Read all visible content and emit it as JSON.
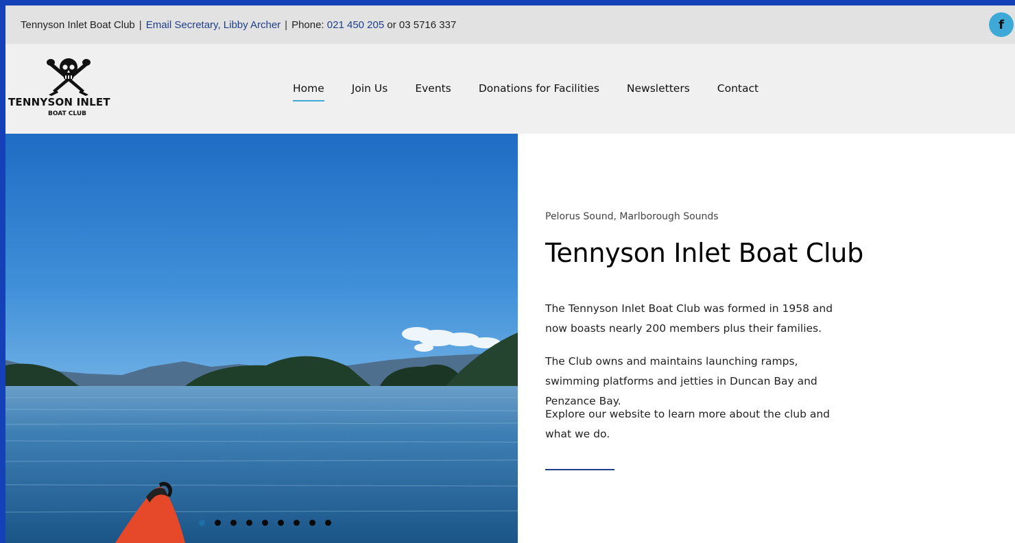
{
  "topbar": {
    "club_name": "Tennyson Inlet Boat Club",
    "separator": "|",
    "email_link": "Email Secretary, Libby Archer",
    "phone_label": "Phone:",
    "phone_primary": "021 450 205",
    "phone_or": "or 03 5716 337",
    "facebook_glyph": "f"
  },
  "logo": {
    "line1": "TENNYSON INLET",
    "line2": "BOAT CLUB"
  },
  "nav": {
    "items": [
      {
        "label": "Home",
        "active": true
      },
      {
        "label": "Join Us",
        "active": false
      },
      {
        "label": "Events",
        "active": false
      },
      {
        "label": "Donations for Facilities",
        "active": false
      },
      {
        "label": "Newsletters",
        "active": false
      },
      {
        "label": "Contact",
        "active": false
      }
    ]
  },
  "hero": {
    "slide_count": 9,
    "active_slide": 0
  },
  "content": {
    "subtitle": "Pelorus Sound, Marlborough Sounds",
    "title": "Tennyson Inlet Boat Club",
    "paragraphs": [
      "The Tennyson Inlet Boat Club was formed in 1958 and now boasts nearly 200 members plus their families.",
      "The Club owns and maintains launching ramps, swimming platforms and jetties in Duncan Bay and Penzance Bay.",
      "Explore our website to learn more about the club and what we do."
    ]
  },
  "colors": {
    "frame": "#1440b8",
    "link": "#1d3f8a",
    "accent": "#3ea9d6",
    "topbar_bg": "#e2e2e2",
    "header_bg": "#f0f0f0"
  },
  "icons": {
    "facebook": "facebook-icon",
    "logo": "skull-crossed-oars-icon"
  }
}
